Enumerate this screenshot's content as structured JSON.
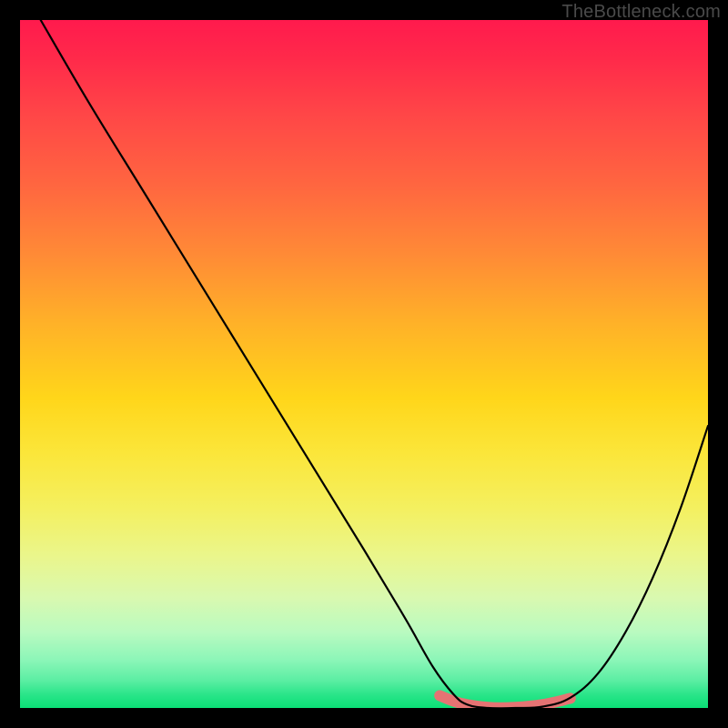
{
  "watermark": "TheBottleneck.com",
  "chart_data": {
    "type": "line",
    "title": "",
    "xlabel": "",
    "ylabel": "",
    "xlim": [
      0,
      100
    ],
    "ylim": [
      0,
      100
    ],
    "series": [
      {
        "name": "black-curve",
        "color": "#000000",
        "x": [
          3,
          10,
          18,
          26,
          34,
          42,
          50,
          56,
          60,
          63,
          65,
          68,
          72,
          76,
          80,
          84,
          88,
          92,
          96,
          100
        ],
        "y": [
          100,
          88,
          75,
          62,
          49,
          36,
          23,
          13,
          6,
          2,
          0.5,
          0,
          0,
          0.2,
          1.5,
          5,
          11,
          19,
          29,
          41
        ]
      },
      {
        "name": "pink-highlight",
        "color": "#e57373",
        "x": [
          61,
          64,
          68,
          72,
          76,
          80
        ],
        "y": [
          1.8,
          0.7,
          0.1,
          0.1,
          0.5,
          1.4
        ]
      }
    ],
    "background_gradient": {
      "top": "#ff1a4d",
      "mid": "#ffd61a",
      "bottom": "#0adf76"
    }
  }
}
